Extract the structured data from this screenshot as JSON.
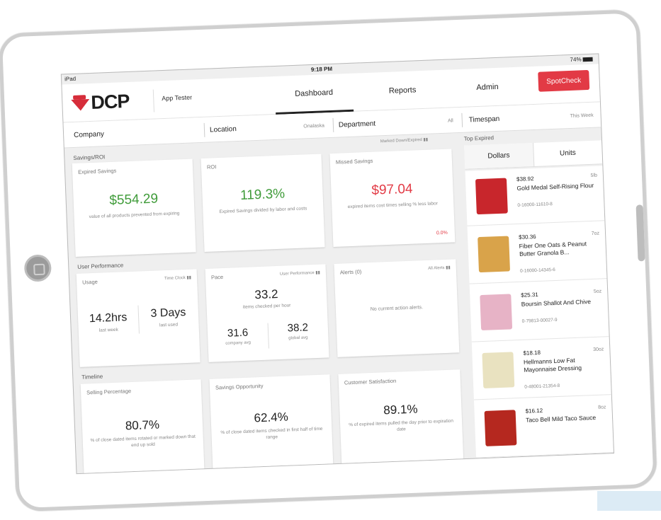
{
  "status": {
    "device": "iPad",
    "time": "9:18 PM",
    "battery": "74%"
  },
  "header": {
    "logo_text": "DCP",
    "user": "App Tester",
    "nav": [
      "Dashboard",
      "Reports",
      "Admin"
    ],
    "spotcheck_label": "SpotCheck"
  },
  "filters": {
    "company": "Company",
    "location": "Location",
    "location_value": "Onalaska",
    "department": "Department",
    "department_value": "All",
    "timespan": "Timespan",
    "timespan_value": "This Week"
  },
  "sections": {
    "savings": "Savings/ROI",
    "savings_right": "Marked Down/Expired",
    "user_perf": "User Performance",
    "timeline": "Timeline"
  },
  "cards": {
    "expired_savings": {
      "title": "Expired Savings",
      "value": "$554.29",
      "desc": "value of all products prevented from expiring"
    },
    "roi": {
      "title": "ROI",
      "value": "119.3%",
      "desc": "Expired Savings divided by labor and costs"
    },
    "missed_savings": {
      "title": "Missed Savings",
      "value": "$97.04",
      "desc": "expired items cost times selling % less labor",
      "pct": "0.0%"
    },
    "usage": {
      "title": "Usage",
      "right": "Time Clock",
      "v1": "14.2hrs",
      "v1_sub": "last week",
      "v2": "3 Days",
      "v2_sub": "last used"
    },
    "pace": {
      "title": "Pace",
      "right": "User Performance",
      "value": "33.2",
      "desc": "items checked per hour",
      "v1": "31.6",
      "v1_sub": "company avg",
      "v2": "38.2",
      "v2_sub": "global avg"
    },
    "alerts": {
      "title": "Alerts (0)",
      "right": "All Alerts",
      "desc": "No current action alerts."
    },
    "selling": {
      "title": "Selling Percentage",
      "value": "80.7%",
      "desc": "% of close dated items rotated or marked down that end up sold"
    },
    "opportunity": {
      "title": "Savings Opportunity",
      "value": "62.4%",
      "desc": "% of close dated items checked in first half of time range"
    },
    "satisfaction": {
      "title": "Customer Satisfaction",
      "value": "89.1%",
      "desc": "% of expired items pulled the day prior to expiration date"
    }
  },
  "top_expired": {
    "title": "Top Expired",
    "tabs": [
      "Dollars",
      "Units"
    ],
    "items": [
      {
        "price": "$38.92",
        "size": "5lb",
        "name": "Gold Medal Self-Rising Flour",
        "upc": "0-16000-11610-8",
        "color": "#c8262c"
      },
      {
        "price": "$30.36",
        "size": "7oz",
        "name": "Fiber One Oats & Peanut Butter Granola B...",
        "upc": "0-16000-14345-6",
        "color": "#d9a34a"
      },
      {
        "price": "$25.31",
        "size": "5oz",
        "name": "Boursin Shallot And Chive",
        "upc": "0-79813-00027-9",
        "color": "#e7b3c6"
      },
      {
        "price": "$18.18",
        "size": "30oz",
        "name": "Hellmanns Low Fat Mayonnaise Dressing",
        "upc": "0-48001-21354-8",
        "color": "#e9e2c0"
      },
      {
        "price": "$16.12",
        "size": "8oz",
        "name": "Taco Bell Mild Taco Sauce",
        "upc": "",
        "color": "#b5281f"
      }
    ]
  },
  "icons": [
    "bar-chart-icon",
    "home-button-icon",
    "battery-icon"
  ]
}
